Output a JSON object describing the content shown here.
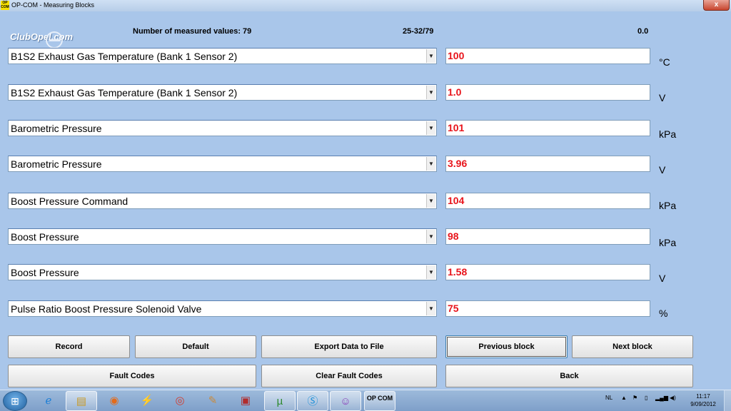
{
  "window": {
    "title": "OP-COM - Measuring Blocks",
    "app_icon_text": "OP COM",
    "close_label": "x"
  },
  "logo": "ClubOpel.com",
  "header": {
    "measured_values": "Number of measured values: 79",
    "range": "25-32/79",
    "time": "0.0"
  },
  "rows": [
    {
      "label": "B1S2 Exhaust Gas Temperature (Bank 1 Sensor 2)",
      "value": "100",
      "unit": "°C"
    },
    {
      "label": "B1S2 Exhaust Gas Temperature (Bank 1 Sensor 2)",
      "value": "1.0",
      "unit": "V"
    },
    {
      "label": "Barometric Pressure",
      "value": "101",
      "unit": "kPa"
    },
    {
      "label": "Barometric Pressure",
      "value": "3.96",
      "unit": "V"
    },
    {
      "label": "Boost Pressure Command",
      "value": "104",
      "unit": "kPa"
    },
    {
      "label": "Boost Pressure",
      "value": "98",
      "unit": "kPa"
    },
    {
      "label": "Boost Pressure",
      "value": "1.58",
      "unit": "V"
    },
    {
      "label": "Pulse Ratio Boost Pressure Solenoid Valve",
      "value": "75",
      "unit": "%"
    }
  ],
  "buttons": {
    "record": "Record",
    "default": "Default",
    "export": "Export Data to File",
    "previous": "Previous block",
    "next": "Next block",
    "fault_codes": "Fault Codes",
    "clear_fault_codes": "Clear Fault Codes",
    "back": "Back"
  },
  "taskbar": {
    "opcom_label": "OP COM",
    "language": "NL",
    "time": "11:17",
    "date": "9/09/2012"
  },
  "colors": {
    "background": "#a9c6ea",
    "value_text": "#e8141b"
  }
}
